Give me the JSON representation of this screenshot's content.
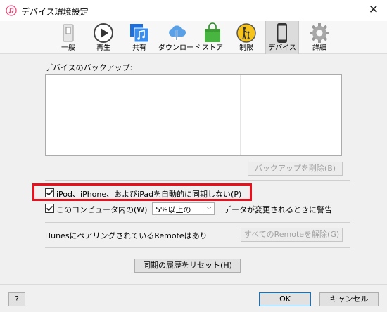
{
  "window": {
    "title": "デバイス環境設定",
    "close_glyph": "✕"
  },
  "toolbar": {
    "items": [
      {
        "label": "一般",
        "icon": "general-switch-icon"
      },
      {
        "label": "再生",
        "icon": "play-icon"
      },
      {
        "label": "共有",
        "icon": "share-music-icon"
      },
      {
        "label": "ダウンロード",
        "icon": "cloud-download-icon"
      },
      {
        "label": "ストア",
        "icon": "store-bag-icon"
      },
      {
        "label": "制限",
        "icon": "parental-restriction-icon"
      },
      {
        "label": "デバイス",
        "icon": "device-icon",
        "selected": true
      },
      {
        "label": "詳細",
        "icon": "gear-icon"
      }
    ]
  },
  "backup": {
    "label": "デバイスのバックアップ:",
    "delete_button": "バックアップを削除(B)"
  },
  "options": {
    "prevent_sync_label": "iPod、iPhone、およびiPadを自動的に同期しない(P)",
    "prevent_sync_checked": true,
    "warn_prefix_label": "このコンピュータ内の(W)",
    "warn_checked": true,
    "warn_threshold": "5%以上の",
    "warn_suffix_label": "データが変更されるときに警告"
  },
  "remote": {
    "paired_text": "iTunesにペアリングされているRemoteはあり",
    "remove_all_button": "すべてのRemoteを解除(G)"
  },
  "reset": {
    "button": "同期の履歴をリセット(H)"
  },
  "footer": {
    "help": "?",
    "ok": "OK",
    "cancel": "キャンセル"
  },
  "colors": {
    "highlight_border": "#e8101c",
    "selected_tab": "#dcdcdc"
  }
}
